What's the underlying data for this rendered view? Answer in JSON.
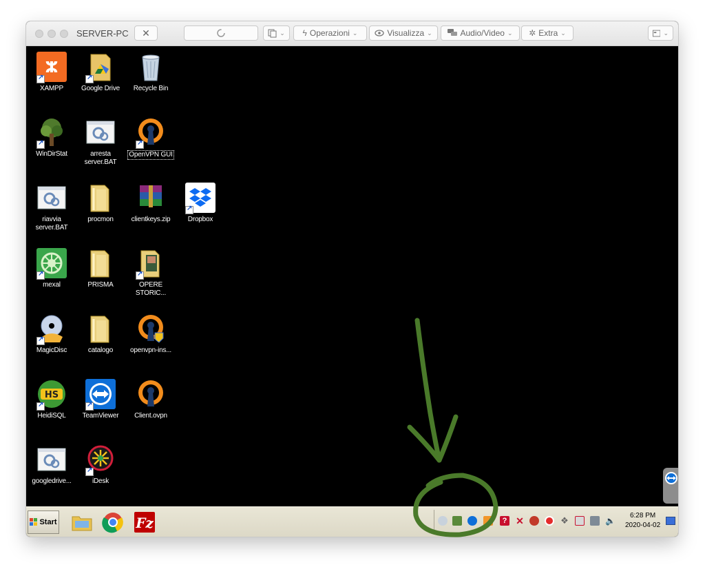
{
  "window": {
    "title": "SERVER-PC"
  },
  "toolbar": {
    "close_glyph": "✕",
    "menus": [
      {
        "label": "Operazioni",
        "icon": "lightning-icon"
      },
      {
        "label": "Visualizza",
        "icon": "eye-icon"
      },
      {
        "label": "Audio/Video",
        "icon": "chat-icon"
      },
      {
        "label": "Extra",
        "icon": "tools-icon"
      }
    ]
  },
  "desktop_icons": [
    {
      "label": "XAMPP",
      "icon": "xampp-icon",
      "shortcut": true
    },
    {
      "label": "Google Drive",
      "icon": "google-drive-folder-icon",
      "shortcut": true
    },
    {
      "label": "Recycle Bin",
      "icon": "recycle-bin-icon",
      "shortcut": false
    },
    {
      "label": "WinDirStat",
      "icon": "windirstat-icon",
      "shortcut": true
    },
    {
      "label": "arresta server.BAT",
      "icon": "batch-file-icon",
      "shortcut": false
    },
    {
      "label": "OpenVPN GUI",
      "icon": "openvpn-icon",
      "shortcut": true,
      "selected": true
    },
    {
      "label": "riavvia server.BAT",
      "icon": "batch-file-icon",
      "shortcut": false
    },
    {
      "label": "procmon",
      "icon": "folder-icon",
      "shortcut": false
    },
    {
      "label": "clientkeys.zip",
      "icon": "winrar-archive-icon",
      "shortcut": false
    },
    {
      "label": "Dropbox",
      "icon": "dropbox-icon",
      "shortcut": true
    },
    {
      "label": "mexal",
      "icon": "mexal-icon",
      "shortcut": true
    },
    {
      "label": "PRISMA",
      "icon": "folder-icon",
      "shortcut": false
    },
    {
      "label": "OPERE STORIC...",
      "icon": "folder-shortcut-icon",
      "shortcut": true
    },
    {
      "label": "MagicDisc",
      "icon": "magicdisc-icon",
      "shortcut": true
    },
    {
      "label": "catalogo",
      "icon": "folder-icon",
      "shortcut": false
    },
    {
      "label": "openvpn-ins...",
      "icon": "openvpn-installer-icon",
      "shortcut": false
    },
    {
      "label": "HeidiSQL",
      "icon": "heidisql-icon",
      "shortcut": true
    },
    {
      "label": "TeamViewer",
      "icon": "teamviewer-icon",
      "shortcut": true
    },
    {
      "label": "Client.ovpn",
      "icon": "openvpn-icon",
      "shortcut": false
    },
    {
      "label": "googledrive...",
      "icon": "batch-file-icon",
      "shortcut": false
    },
    {
      "label": "iDesk",
      "icon": "idesk-icon",
      "shortcut": true
    }
  ],
  "taskbar": {
    "start_label": "Start",
    "quick_launch": [
      "file-explorer-icon",
      "chrome-icon",
      "filezilla-icon"
    ],
    "tray_icons": [
      "clock-app-icon",
      "network-icon",
      "teamviewer-tray-icon",
      "app-tray-icon",
      "help-icon",
      "x-tray-icon",
      "usb-icon",
      "antivirus-icon",
      "dropbox-tray-icon",
      "network-error-icon",
      "monitor-icon",
      "volume-icon"
    ],
    "clock_time": "6:28 PM",
    "clock_date": "2020-04-02"
  },
  "colors": {
    "annotation": "#4a7a2a",
    "desktop": "#000000",
    "taskbar": "#e4e1d1"
  }
}
